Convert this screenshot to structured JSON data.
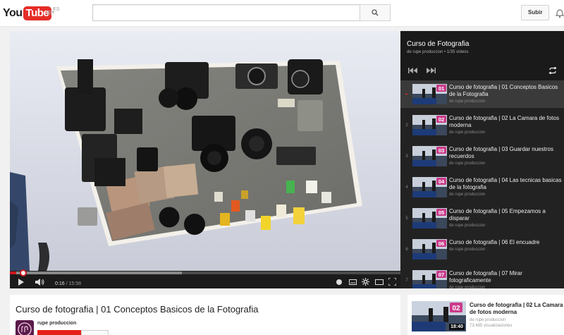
{
  "header": {
    "logo_you": "You",
    "logo_tube": "Tube",
    "region": "ES",
    "search_placeholder": "",
    "upload_label": "Subir"
  },
  "player": {
    "current_time": "0:16",
    "separator": " / ",
    "duration": "15:58",
    "progress": 0.017,
    "buffered": 0.44
  },
  "playlist": {
    "title": "Curso de Fotografia",
    "subtitle": "de rupe produccion • 1/35 videos",
    "items": [
      {
        "index": "▸",
        "title": "Curso de fotografia | 01 Conceptos Basicos de la Fotografia",
        "channel": "de rupe produccion",
        "badge": "01",
        "active": true
      },
      {
        "index": "2",
        "title": "Curso de fotografia | 02 La Camara de fotos moderna",
        "channel": "de rupe produccion",
        "badge": "02",
        "active": false
      },
      {
        "index": "3",
        "title": "Curso de fotografia | 03 Guardar nuestros recuerdos",
        "channel": "de rupe produccion",
        "badge": "03",
        "active": false
      },
      {
        "index": "4",
        "title": "Curso de fotografia | 04 Las tecnicas basicas de la fotografia",
        "channel": "de rupe produccion",
        "badge": "04",
        "active": false
      },
      {
        "index": "5",
        "title": "Curso de fotografia | 05 Empezamos a disparar",
        "channel": "de rupe produccion",
        "badge": "05",
        "active": false
      },
      {
        "index": "6",
        "title": "Curso de fotografia | 06 El encuadre",
        "channel": "de rupe produccion",
        "badge": "06",
        "active": false
      },
      {
        "index": "7",
        "title": "Curso de fotografia | 07 Mirar fotograficamente",
        "channel": "de rupe produccion",
        "badge": "07",
        "active": false
      }
    ]
  },
  "video": {
    "title": "Curso de fotografia | 01 Conceptos Basicos de la Fotografia",
    "channel": "rupe produccion"
  },
  "related": {
    "title": "Curso de fotografia | 02 La Camara de fotos moderna",
    "channel": "de rupe produccion",
    "views": "73.485 visualizaciones",
    "duration": "18:40",
    "badge": "02"
  },
  "colors": {
    "brand_red": "#e52d27",
    "progress_red": "#cc181e"
  }
}
